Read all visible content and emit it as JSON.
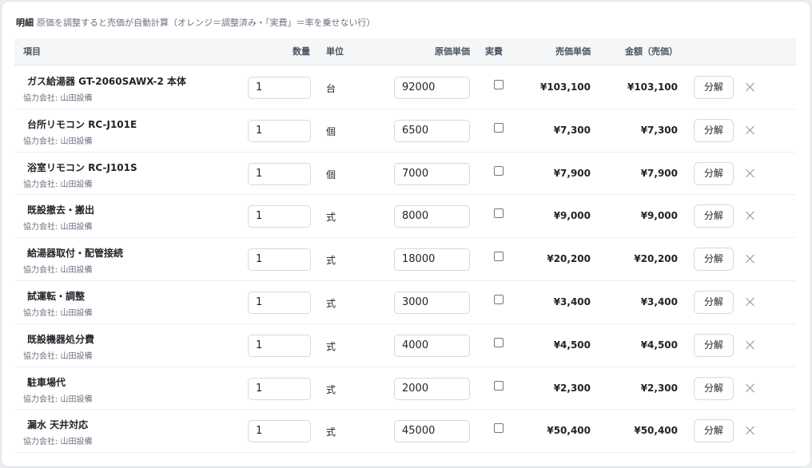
{
  "caption": {
    "title": "明細",
    "description": "原価を調整すると売価が自動計算（オレンジ＝調整済み・「実費」＝率を乗せない行）"
  },
  "table": {
    "headers": {
      "item": "項目",
      "qty": "数量",
      "unit": "単位",
      "cost": "原価単価",
      "actual": "実費",
      "unit_price": "売価単価",
      "amount": "金額（売価）"
    },
    "rows": [
      {
        "name": "ガス給湯器 GT-2060SAWX-2 本体",
        "vendor": "協力会社: 山田設備",
        "qty": "1",
        "unit": "台",
        "cost": "92000",
        "actual": false,
        "unit_price": "¥103,100",
        "amount": "¥103,100",
        "action": "分解",
        "remove_icon": "close-icon"
      },
      {
        "name": "台所リモコン RC-J101E",
        "vendor": "協力会社: 山田設備",
        "qty": "1",
        "unit": "個",
        "cost": "6500",
        "actual": false,
        "unit_price": "¥7,300",
        "amount": "¥7,300",
        "action": "分解",
        "remove_icon": "close-icon"
      },
      {
        "name": "浴室リモコン RC-J101S",
        "vendor": "協力会社: 山田設備",
        "qty": "1",
        "unit": "個",
        "cost": "7000",
        "actual": false,
        "unit_price": "¥7,900",
        "amount": "¥7,900",
        "action": "分解",
        "remove_icon": "close-icon"
      },
      {
        "name": "既設撤去・搬出",
        "vendor": "協力会社: 山田設備",
        "qty": "1",
        "unit": "式",
        "cost": "8000",
        "actual": false,
        "unit_price": "¥9,000",
        "amount": "¥9,000",
        "action": "分解",
        "remove_icon": "close-icon"
      },
      {
        "name": "給湯器取付・配管接続",
        "vendor": "協力会社: 山田設備",
        "qty": "1",
        "unit": "式",
        "cost": "18000",
        "actual": false,
        "unit_price": "¥20,200",
        "amount": "¥20,200",
        "action": "分解",
        "remove_icon": "close-icon"
      },
      {
        "name": "試運転・調整",
        "vendor": "協力会社: 山田設備",
        "qty": "1",
        "unit": "式",
        "cost": "3000",
        "actual": false,
        "unit_price": "¥3,400",
        "amount": "¥3,400",
        "action": "分解",
        "remove_icon": "close-icon"
      },
      {
        "name": "既設機器処分費",
        "vendor": "協力会社: 山田設備",
        "qty": "1",
        "unit": "式",
        "cost": "4000",
        "actual": false,
        "unit_price": "¥4,500",
        "amount": "¥4,500",
        "action": "分解",
        "remove_icon": "close-icon"
      },
      {
        "name": "駐車場代",
        "vendor": "協力会社: 山田設備",
        "qty": "1",
        "unit": "式",
        "cost": "2000",
        "actual": false,
        "unit_price": "¥2,300",
        "amount": "¥2,300",
        "action": "分解",
        "remove_icon": "close-icon"
      },
      {
        "name": "漏水 天井対応",
        "vendor": "協力会社: 山田設備",
        "qty": "1",
        "unit": "式",
        "cost": "45000",
        "actual": false,
        "unit_price": "¥50,400",
        "amount": "¥50,400",
        "action": "分解",
        "remove_icon": "close-icon"
      }
    ]
  }
}
